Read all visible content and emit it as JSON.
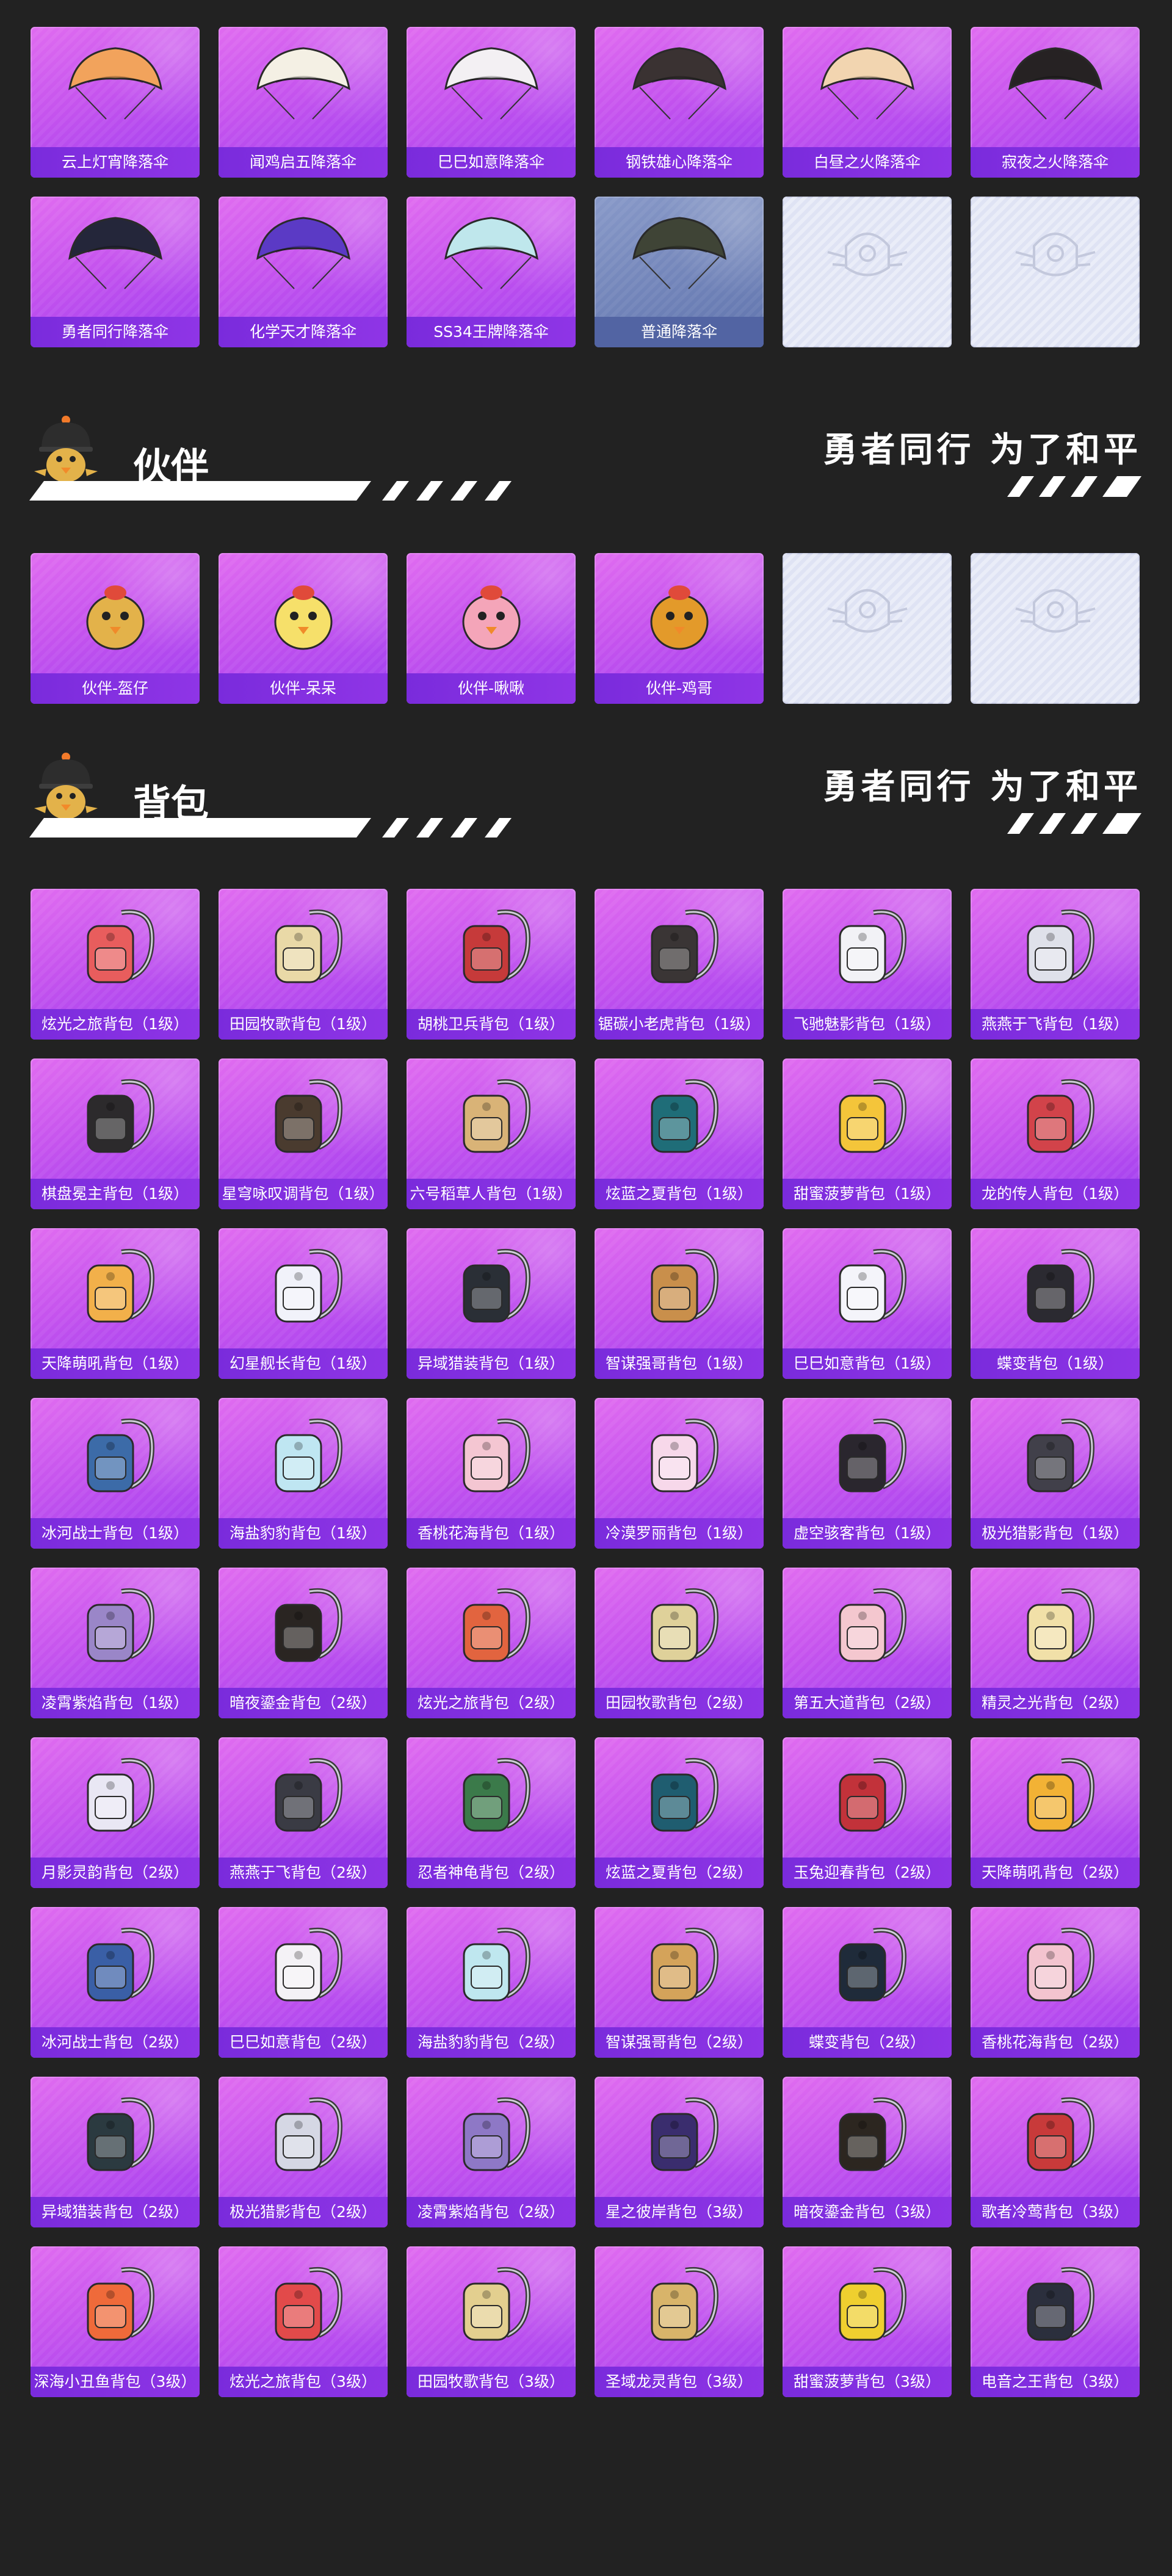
{
  "slogan": "勇者同行 为了和平",
  "parachutes": [
    {
      "label": "云上灯宵降落伞",
      "art": "parachute",
      "color": "#f2a35c"
    },
    {
      "label": "闻鸡启五降落伞",
      "art": "parachute",
      "color": "#f4f0e4"
    },
    {
      "label": "巳巳如意降落伞",
      "art": "parachute",
      "color": "#f3f0f3"
    },
    {
      "label": "钢铁雄心降落伞",
      "art": "parachute",
      "color": "#3a3232"
    },
    {
      "label": "白昼之火降落伞",
      "art": "parachute",
      "color": "#f2d5b0"
    },
    {
      "label": "寂夜之火降落伞",
      "art": "parachute",
      "color": "#262223"
    },
    {
      "label": "勇者同行降落伞",
      "art": "parachute",
      "color": "#24263a"
    },
    {
      "label": "化学天才降落伞",
      "art": "parachute",
      "color": "#5b3ac5"
    },
    {
      "label": "SS34王牌降落伞",
      "art": "parachute",
      "color": "#bfe7ec"
    },
    {
      "label": "普通降落伞",
      "art": "parachute",
      "color": "#3f4436",
      "plain": true
    },
    {
      "label": "",
      "art": "emblem",
      "empty": true
    },
    {
      "label": "",
      "art": "emblem",
      "empty": true
    }
  ],
  "companion_section": {
    "title": "伙伴"
  },
  "companions": [
    {
      "label": "伙伴-盔仔",
      "art": "mascot",
      "color": "#e3b24a"
    },
    {
      "label": "伙伴-呆呆",
      "art": "mascot",
      "color": "#f6e06a"
    },
    {
      "label": "伙伴-啾啾",
      "art": "mascot",
      "color": "#f4a5b9"
    },
    {
      "label": "伙伴-鸡哥",
      "art": "mascot",
      "color": "#e39a2a"
    },
    {
      "label": "",
      "art": "emblem",
      "empty": true
    },
    {
      "label": "",
      "art": "emblem",
      "empty": true
    }
  ],
  "backpack_section": {
    "title": "背包"
  },
  "backpacks": [
    {
      "label": "炫光之旅背包（1级）",
      "art": "backpack",
      "color": "#e85d5d"
    },
    {
      "label": "田园牧歌背包（1级）",
      "art": "backpack",
      "color": "#e9d9a7"
    },
    {
      "label": "胡桃卫兵背包（1级）",
      "art": "backpack",
      "color": "#c63a3a"
    },
    {
      "label": "锯碳小老虎背包（1级）",
      "art": "backpack",
      "color": "#3a3535"
    },
    {
      "label": "飞驰魅影背包（1级）",
      "art": "backpack",
      "color": "#f2f2f6"
    },
    {
      "label": "燕燕于飞背包（1级）",
      "art": "backpack",
      "color": "#dfe1ea"
    },
    {
      "label": "棋盘冕主背包（1级）",
      "art": "backpack",
      "color": "#2c2a2c"
    },
    {
      "label": "星穹咏叹调背包（1级）",
      "art": "backpack",
      "color": "#4a3b2f"
    },
    {
      "label": "六号稻草人背包（1级）",
      "art": "backpack",
      "color": "#d9b377"
    },
    {
      "label": "炫蓝之夏背包（1级）",
      "art": "backpack",
      "color": "#1f6d78"
    },
    {
      "label": "甜蜜菠萝背包（1级）",
      "art": "backpack",
      "color": "#f4c53a"
    },
    {
      "label": "龙的传人背包（1级）",
      "art": "backpack",
      "color": "#d2434a"
    },
    {
      "label": "天降萌吼背包（1级）",
      "art": "backpack",
      "color": "#f2b04a"
    },
    {
      "label": "幻星舰长背包（1级）",
      "art": "backpack",
      "color": "#f1f2fa"
    },
    {
      "label": "异域猎装背包（1级）",
      "art": "backpack",
      "color": "#2a2f36"
    },
    {
      "label": "智谋强哥背包（1级）",
      "art": "backpack",
      "color": "#c98f4b"
    },
    {
      "label": "巳巳如意背包（1级）",
      "art": "backpack",
      "color": "#f4f4fa"
    },
    {
      "label": "蝶变背包（1级）",
      "art": "backpack",
      "color": "#2b2a31"
    },
    {
      "label": "冰河战士背包（1级）",
      "art": "backpack",
      "color": "#3c6ba8"
    },
    {
      "label": "海盐豹豹背包（1级）",
      "art": "backpack",
      "color": "#bfe6f2"
    },
    {
      "label": "香桃花海背包（1级）",
      "art": "backpack",
      "color": "#f4c6d2"
    },
    {
      "label": "冷漠罗丽背包（1级）",
      "art": "backpack",
      "color": "#f7d8ea"
    },
    {
      "label": "虚空骇客背包（1级）",
      "art": "backpack",
      "color": "#2a262e"
    },
    {
      "label": "极光猎影背包（1级）",
      "art": "backpack",
      "color": "#41404a"
    },
    {
      "label": "凌霄紫焰背包（1级）",
      "art": "backpack",
      "color": "#9a86c8"
    },
    {
      "label": "暗夜鎏金背包（2级）",
      "art": "backpack",
      "color": "#2a2522"
    },
    {
      "label": "炫光之旅背包（2级）",
      "art": "backpack",
      "color": "#e2643f"
    },
    {
      "label": "田园牧歌背包（2级）",
      "art": "backpack",
      "color": "#dfd19a"
    },
    {
      "label": "第五大道背包（2级）",
      "art": "backpack",
      "color": "#f4c7cf"
    },
    {
      "label": "精灵之光背包（2级）",
      "art": "backpack",
      "color": "#f1e0a8"
    },
    {
      "label": "月影灵韵背包（2级）",
      "art": "backpack",
      "color": "#e9e7f4"
    },
    {
      "label": "燕燕于飞背包（2级）",
      "art": "backpack",
      "color": "#3a3b44"
    },
    {
      "label": "忍者神龟背包（2级）",
      "art": "backpack",
      "color": "#3b7a4a"
    },
    {
      "label": "炫蓝之夏背包（2级）",
      "art": "backpack",
      "color": "#1f5d70"
    },
    {
      "label": "玉兔迎春背包（2级）",
      "art": "backpack",
      "color": "#c2323a"
    },
    {
      "label": "天降萌吼背包（2级）",
      "art": "backpack",
      "color": "#f2b235"
    },
    {
      "label": "冰河战士背包（2级）",
      "art": "backpack",
      "color": "#3a5fa6"
    },
    {
      "label": "巳巳如意背包（2级）",
      "art": "backpack",
      "color": "#f4f2f6"
    },
    {
      "label": "海盐豹豹背包（2级）",
      "art": "backpack",
      "color": "#bfe7ef"
    },
    {
      "label": "智谋强哥背包（2级）",
      "art": "backpack",
      "color": "#d4a35a"
    },
    {
      "label": "蝶变背包（2级）",
      "art": "backpack",
      "color": "#1f2b3a"
    },
    {
      "label": "香桃花海背包（2级）",
      "art": "backpack",
      "color": "#f3c4cf"
    },
    {
      "label": "异域猎装背包（2级）",
      "art": "backpack",
      "color": "#2b3a40"
    },
    {
      "label": "极光猎影背包（2级）",
      "art": "backpack",
      "color": "#d5d7e4"
    },
    {
      "label": "凌霄紫焰背包（2级）",
      "art": "backpack",
      "color": "#8e78c6"
    },
    {
      "label": "星之彼岸背包（3级）",
      "art": "backpack",
      "color": "#3a2d6e"
    },
    {
      "label": "暗夜鎏金背包（3级）",
      "art": "backpack",
      "color": "#2c2620"
    },
    {
      "label": "歌者冷莺背包（3级）",
      "art": "backpack",
      "color": "#c83a3a"
    },
    {
      "label": "深海小丑鱼背包（3级）",
      "art": "backpack",
      "color": "#ef6a3a"
    },
    {
      "label": "炫光之旅背包（3级）",
      "art": "backpack",
      "color": "#e24a4a"
    },
    {
      "label": "田园牧歌背包（3级）",
      "art": "backpack",
      "color": "#e3cf8f"
    },
    {
      "label": "圣域龙灵背包（3级）",
      "art": "backpack",
      "color": "#d8b46a"
    },
    {
      "label": "甜蜜菠萝背包（3级）",
      "art": "backpack",
      "color": "#efcf2f"
    },
    {
      "label": "电音之王背包（3级）",
      "art": "backpack",
      "color": "#2b2f3d"
    }
  ]
}
